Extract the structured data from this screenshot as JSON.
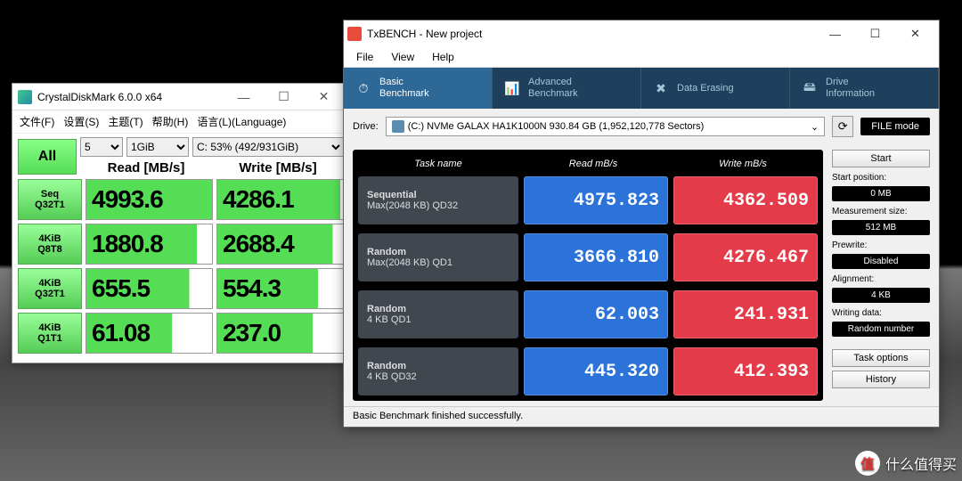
{
  "cdm": {
    "title": "CrystalDiskMark 6.0.0 x64",
    "menu": [
      "文件(F)",
      "设置(S)",
      "主题(T)",
      "帮助(H)",
      "语言(L)(Language)"
    ],
    "all_label": "All",
    "passes": "5",
    "size": "1GiB",
    "drive": "C: 53% (492/931GiB)",
    "head_read": "Read [MB/s]",
    "head_write": "Write [MB/s]",
    "rows": [
      {
        "label1": "Seq",
        "label2": "Q32T1",
        "read": "4993.6",
        "write": "4286.1",
        "rfill": "100%",
        "wfill": "98%"
      },
      {
        "label1": "4KiB",
        "label2": "Q8T8",
        "read": "1880.8",
        "write": "2688.4",
        "rfill": "88%",
        "wfill": "92%"
      },
      {
        "label1": "4KiB",
        "label2": "Q32T1",
        "read": "655.5",
        "write": "554.3",
        "rfill": "82%",
        "wfill": "80%"
      },
      {
        "label1": "4KiB",
        "label2": "Q1T1",
        "read": "61.08",
        "write": "237.0",
        "rfill": "68%",
        "wfill": "76%"
      }
    ]
  },
  "txb": {
    "title": "TxBENCH - New project",
    "menu": [
      "File",
      "View",
      "Help"
    ],
    "tabs": [
      {
        "id": "basic",
        "line1": "Basic",
        "line2": "Benchmark",
        "icon": "⏱"
      },
      {
        "id": "advanced",
        "line1": "Advanced",
        "line2": "Benchmark",
        "icon": "📊"
      },
      {
        "id": "erase",
        "line1": "Data Erasing",
        "line2": "",
        "icon": "✖"
      },
      {
        "id": "info",
        "line1": "Drive",
        "line2": "Information",
        "icon": "🖴"
      }
    ],
    "drive_label": "Drive:",
    "drive_value": "(C:) NVMe GALAX HA1K1000N  930.84 GB (1,952,120,778 Sectors)",
    "filemode": "FILE mode",
    "thead": {
      "task": "Task name",
      "read": "Read mB/s",
      "write": "Write mB/s"
    },
    "rows": [
      {
        "task1": "Sequential",
        "task2": "Max(2048 KB) QD32",
        "read": "4975.823",
        "write": "4362.509"
      },
      {
        "task1": "Random",
        "task2": "Max(2048 KB) QD1",
        "read": "3666.810",
        "write": "4276.467"
      },
      {
        "task1": "Random",
        "task2": "4 KB QD1",
        "read": "62.003",
        "write": "241.931"
      },
      {
        "task1": "Random",
        "task2": "4 KB QD32",
        "read": "445.320",
        "write": "412.393"
      }
    ],
    "side": {
      "start": "Start",
      "startpos_label": "Start position:",
      "startpos": "0 MB",
      "meassize_label": "Measurement size:",
      "meassize": "512 MB",
      "prewrite_label": "Prewrite:",
      "prewrite": "Disabled",
      "alignment_label": "Alignment:",
      "alignment": "4 KB",
      "writing_label": "Writing data:",
      "writing": "Random number",
      "taskopt": "Task options",
      "history": "History"
    },
    "status": "Basic Benchmark finished successfully."
  },
  "watermark": "什么值得买",
  "chart_data": [
    {
      "type": "table",
      "title": "CrystalDiskMark 6.0.0 benchmark results (MB/s)",
      "rows": [
        "Seq Q32T1",
        "4KiB Q8T8",
        "4KiB Q32T1",
        "4KiB Q1T1"
      ],
      "columns": [
        "Read",
        "Write"
      ],
      "values": [
        [
          4993.6,
          4286.1
        ],
        [
          1880.8,
          2688.4
        ],
        [
          655.5,
          554.3
        ],
        [
          61.08,
          237.0
        ]
      ]
    },
    {
      "type": "table",
      "title": "TxBENCH Basic Benchmark results (MB/s)",
      "rows": [
        "Sequential Max(2048 KB) QD32",
        "Random Max(2048 KB) QD1",
        "Random 4 KB QD1",
        "Random 4 KB QD32"
      ],
      "columns": [
        "Read",
        "Write"
      ],
      "values": [
        [
          4975.823,
          4362.509
        ],
        [
          3666.81,
          4276.467
        ],
        [
          62.003,
          241.931
        ],
        [
          445.32,
          412.393
        ]
      ]
    }
  ]
}
